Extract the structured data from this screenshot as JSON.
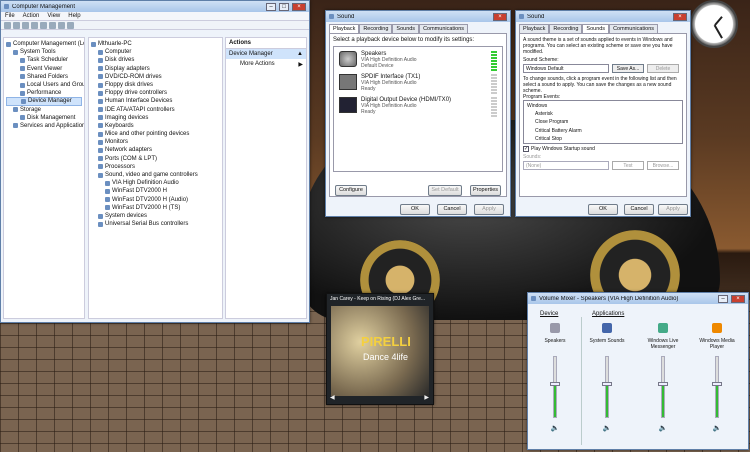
{
  "cm": {
    "title": "Computer Management",
    "menu": [
      "File",
      "Action",
      "View",
      "Help"
    ],
    "left_tree": [
      {
        "label": "Computer Management (Local",
        "d": 0
      },
      {
        "label": "System Tools",
        "d": 1
      },
      {
        "label": "Task Scheduler",
        "d": 2
      },
      {
        "label": "Event Viewer",
        "d": 2
      },
      {
        "label": "Shared Folders",
        "d": 2
      },
      {
        "label": "Local Users and Groups",
        "d": 2
      },
      {
        "label": "Performance",
        "d": 2
      },
      {
        "label": "Device Manager",
        "d": 2,
        "sel": true
      },
      {
        "label": "Storage",
        "d": 1
      },
      {
        "label": "Disk Management",
        "d": 2
      },
      {
        "label": "Services and Applications",
        "d": 1
      }
    ],
    "devices": [
      {
        "label": "Mthuarle-PC",
        "d": 0
      },
      {
        "label": "Computer",
        "d": 1
      },
      {
        "label": "Disk drives",
        "d": 1
      },
      {
        "label": "Display adapters",
        "d": 1
      },
      {
        "label": "DVD/CD-ROM drives",
        "d": 1
      },
      {
        "label": "Floppy disk drives",
        "d": 1
      },
      {
        "label": "Floppy drive controllers",
        "d": 1
      },
      {
        "label": "Human Interface Devices",
        "d": 1
      },
      {
        "label": "IDE ATA/ATAPI controllers",
        "d": 1
      },
      {
        "label": "Imaging devices",
        "d": 1
      },
      {
        "label": "Keyboards",
        "d": 1
      },
      {
        "label": "Mice and other pointing devices",
        "d": 1
      },
      {
        "label": "Monitors",
        "d": 1
      },
      {
        "label": "Network adapters",
        "d": 1
      },
      {
        "label": "Ports (COM & LPT)",
        "d": 1
      },
      {
        "label": "Processors",
        "d": 1
      },
      {
        "label": "Sound, video and game controllers",
        "d": 1
      },
      {
        "label": "VIA High Definition Audio",
        "d": 2
      },
      {
        "label": "WinFast DTV2000 H",
        "d": 2
      },
      {
        "label": "WinFast DTV2000 H (Audio)",
        "d": 2
      },
      {
        "label": "WinFast DTV2000 H (TS)",
        "d": 2
      },
      {
        "label": "System devices",
        "d": 1
      },
      {
        "label": "Universal Serial Bus controllers",
        "d": 1
      }
    ],
    "actions_title": "Actions",
    "actions_section": "Device Manager",
    "more_actions": "More Actions"
  },
  "snd1": {
    "title": "Sound",
    "tabs": [
      "Playback",
      "Recording",
      "Sounds",
      "Communications"
    ],
    "instruction": "Select a playback device below to modify its settings:",
    "devices": [
      {
        "name": "Speakers",
        "driver": "VIA High Definition Audio",
        "status": "Default Device"
      },
      {
        "name": "SPDIF Interface (TX1)",
        "driver": "VIA High Definition Audio",
        "status": "Ready"
      },
      {
        "name": "Digital Output Device (HDMI/TX0)",
        "driver": "VIA High Definition Audio",
        "status": "Ready"
      }
    ],
    "configure": "Configure",
    "set_default": "Set Default",
    "properties": "Properties",
    "ok": "OK",
    "cancel": "Cancel",
    "apply": "Apply"
  },
  "snd2": {
    "title": "Sound",
    "tabs": [
      "Playback",
      "Recording",
      "Sounds",
      "Communications"
    ],
    "desc": "A sound theme is a set of sounds applied to events in Windows and programs. You can select an existing scheme or save one you have modified.",
    "scheme_label": "Sound Scheme:",
    "scheme_value": "Windows Default",
    "save_as": "Save As...",
    "delete": "Delete",
    "desc2": "To change sounds, click a program event in the following list and then select a sound to apply. You can save the changes as a new sound scheme.",
    "events_label": "Program Events:",
    "events": [
      "Windows",
      "Asterisk",
      "Close Program",
      "Critical Battery Alarm",
      "Critical Stop",
      "Default Beep"
    ],
    "play_startup": "Play Windows Startup sound",
    "sounds_label": "Sounds:",
    "sounds_value": "(None)",
    "test": "Test",
    "browse": "Browse...",
    "ok": "OK",
    "cancel": "Cancel",
    "apply": "Apply"
  },
  "media": {
    "title": "Jan Carey - Keep on Rising  (DJ Alex Gre...",
    "art_brand": "PIRELLI",
    "art_sub": "Dance 4life"
  },
  "mixer": {
    "title": "Volume Mixer - Speakers (VIA High Definition Audio)",
    "device_label": "Device",
    "apps_label": "Applications",
    "channels": [
      {
        "name": "Speakers",
        "level": 0.55
      },
      {
        "name": "System Sounds",
        "level": 0.55
      },
      {
        "name": "Windows Live Messenger",
        "level": 0.55
      },
      {
        "name": "Windows Media Player",
        "level": 0.55
      }
    ]
  }
}
